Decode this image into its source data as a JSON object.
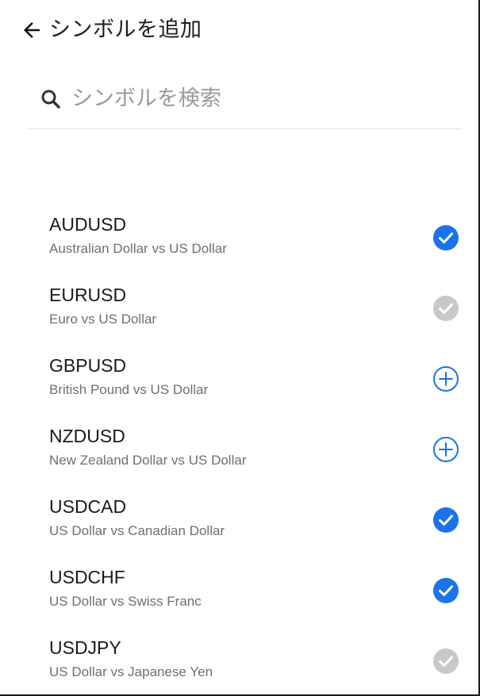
{
  "header": {
    "title": "シンボルを追加",
    "back_icon": "back-arrow-icon"
  },
  "search": {
    "icon": "search-icon",
    "placeholder": "シンボルを検索",
    "value": ""
  },
  "colors": {
    "accent": "#1a73e8",
    "disabled": "#c8c8c8"
  },
  "symbols": [
    {
      "symbol": "AUDUSD",
      "description": "Australian Dollar vs US Dollar",
      "state": "selected",
      "icon": "check-circle-icon"
    },
    {
      "symbol": "EURUSD",
      "description": "Euro vs US Dollar",
      "state": "disabled",
      "icon": "check-circle-icon"
    },
    {
      "symbol": "GBPUSD",
      "description": "British Pound vs US Dollar",
      "state": "add",
      "icon": "add-circle-icon"
    },
    {
      "symbol": "NZDUSD",
      "description": "New Zealand Dollar vs US Dollar",
      "state": "add",
      "icon": "add-circle-icon"
    },
    {
      "symbol": "USDCAD",
      "description": "US Dollar vs Canadian Dollar",
      "state": "selected",
      "icon": "check-circle-icon"
    },
    {
      "symbol": "USDCHF",
      "description": "US Dollar vs Swiss Franc",
      "state": "selected",
      "icon": "check-circle-icon"
    },
    {
      "symbol": "USDJPY",
      "description": "US Dollar vs Japanese Yen",
      "state": "disabled",
      "icon": "check-circle-icon"
    }
  ]
}
